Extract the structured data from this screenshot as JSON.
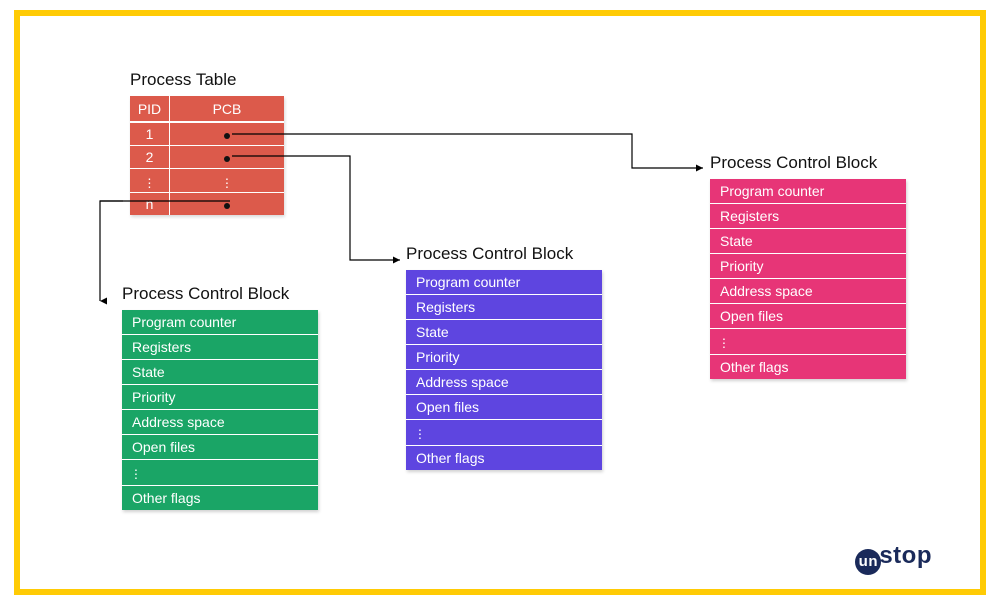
{
  "processTable": {
    "title": "Process Table",
    "columns": {
      "pid": "PID",
      "pcb": "PCB"
    },
    "rows": [
      {
        "pid": "1"
      },
      {
        "pid": "2"
      },
      {
        "pid": "⋮",
        "dots": true
      },
      {
        "pid": "n"
      }
    ]
  },
  "pcbTitle": "Process Control Block",
  "pcbFields": {
    "programCounter": "Program counter",
    "registers": "Registers",
    "state": "State",
    "priority": "Priority",
    "addressSpace": "Address space",
    "openFiles": "Open files",
    "otherFlags": "Other flags"
  },
  "ellipsis": "⋮",
  "logo": {
    "un": "un",
    "stop": "stop"
  }
}
